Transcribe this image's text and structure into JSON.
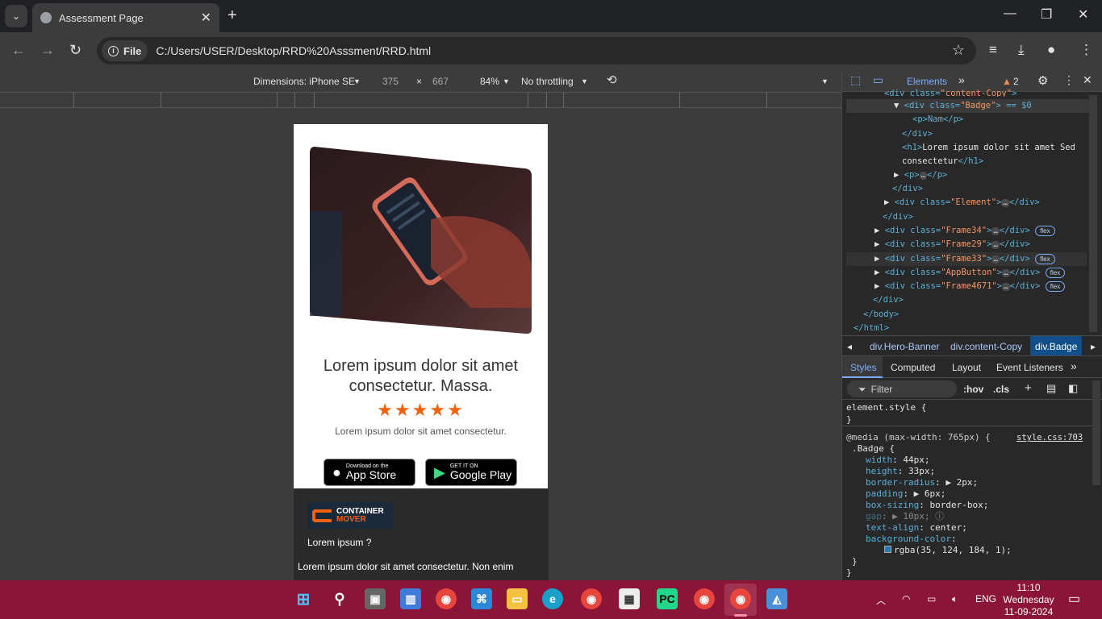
{
  "browser": {
    "tab_title": "Assessment Page",
    "new_tab_icon": "+",
    "site_chip": "File",
    "url": "C:/Users/USER/Desktop/RRD%20Asssment/RRD.html"
  },
  "device_toolbar": {
    "dimensions_label": "Dimensions: iPhone SE",
    "width": "375",
    "times": "×",
    "height": "667",
    "zoom": "84%",
    "throttling": "No throttling"
  },
  "page": {
    "hero_title_line1": "Lorem ipsum dolor sit amet",
    "hero_title_line2": "consectetur. Massa.",
    "stars": "★★★★★",
    "rating": 5,
    "hero_subtitle": "Lorem ipsum dolor sit amet consectetur.",
    "app_store_small": "Download on the",
    "app_store_large": "App Store",
    "google_play_small": "GET IT ON",
    "google_play_large": "Google Play",
    "logo_line1": "CONTAINER",
    "logo_line2": "MOVER",
    "footer_question": "Lorem ipsum ?",
    "footer_paragraph": "Lorem ipsum dolor sit amet consectetur. Non enim"
  },
  "devtools": {
    "elements_tab": "Elements",
    "more_tabs": "»",
    "warning_count": "2",
    "dom_lines": {
      "l0_tag": "<div class=",
      "l0_val": "\"content-Copy\"",
      "l0_end": ">",
      "l1_open": "▼",
      "l1_tag": "<div class=",
      "l1_val": "\"Badge\"",
      "l1_end": "> == $0",
      "l2": "<p>Nam</p>",
      "l3": "</div>",
      "l4a": "<h1>",
      "l4b": "Lorem ipsum dolor sit amet Sed",
      "l5a": "consectetur",
      "l5b": "</h1>",
      "l6": "<p>",
      "l6b": "</p>",
      "l7": "</div>",
      "l8_tag": "<div class=",
      "l8_val": "\"Element\"",
      "l8_end": "</div>",
      "l9": "</div>",
      "l10_val": "\"Frame34\"",
      "l11_val": "\"Frame29\"",
      "l12_val": "\"Frame33\"",
      "l13_val": "\"AppButton\"",
      "l14_val": "\"Frame4671\"",
      "close_div": "</div>",
      "close_body": "</body>",
      "close_html": "</html>",
      "div_tag": "<div class=",
      "div_end": "</div>",
      "flex": "flex",
      "ellipsis": "…",
      "gutter_ellipsis": "..."
    },
    "breadcrumbs": [
      "div.Hero-Banner",
      "div.content-Copy",
      "div.Badge"
    ],
    "style_tabs": [
      "Styles",
      "Computed",
      "Layout",
      "Event Listeners"
    ],
    "filter_placeholder": "Filter",
    "hov": ":hov",
    "cls": ".cls",
    "styles": {
      "element_style": "element.style {",
      "close_brace": "}",
      "media": "@media (max-width: 765px) {",
      "source": "style.css:703",
      "selector": ".Badge {",
      "props": [
        {
          "name": "width",
          "value": "44px;"
        },
        {
          "name": "height",
          "value": "33px;"
        },
        {
          "name": "border-radius",
          "value": "▶ 2px;"
        },
        {
          "name": "padding",
          "value": "▶ 6px;"
        },
        {
          "name": "box-sizing",
          "value": "border-box;"
        },
        {
          "name": "gap",
          "value": "▶ 10px;"
        },
        {
          "name": "text-align",
          "value": "center;"
        },
        {
          "name": "background-color",
          "value": ""
        }
      ],
      "bg_value": "rgba(35, 124, 184, 1);",
      "bg_color": "#237cb8"
    }
  },
  "taskbar": {
    "lang": "ENG",
    "time": "11:10",
    "day": "Wednesday",
    "date": "11-09-2024"
  },
  "colors": {
    "accent_orange": "#f0620f",
    "taskbar": "#8a1538"
  }
}
